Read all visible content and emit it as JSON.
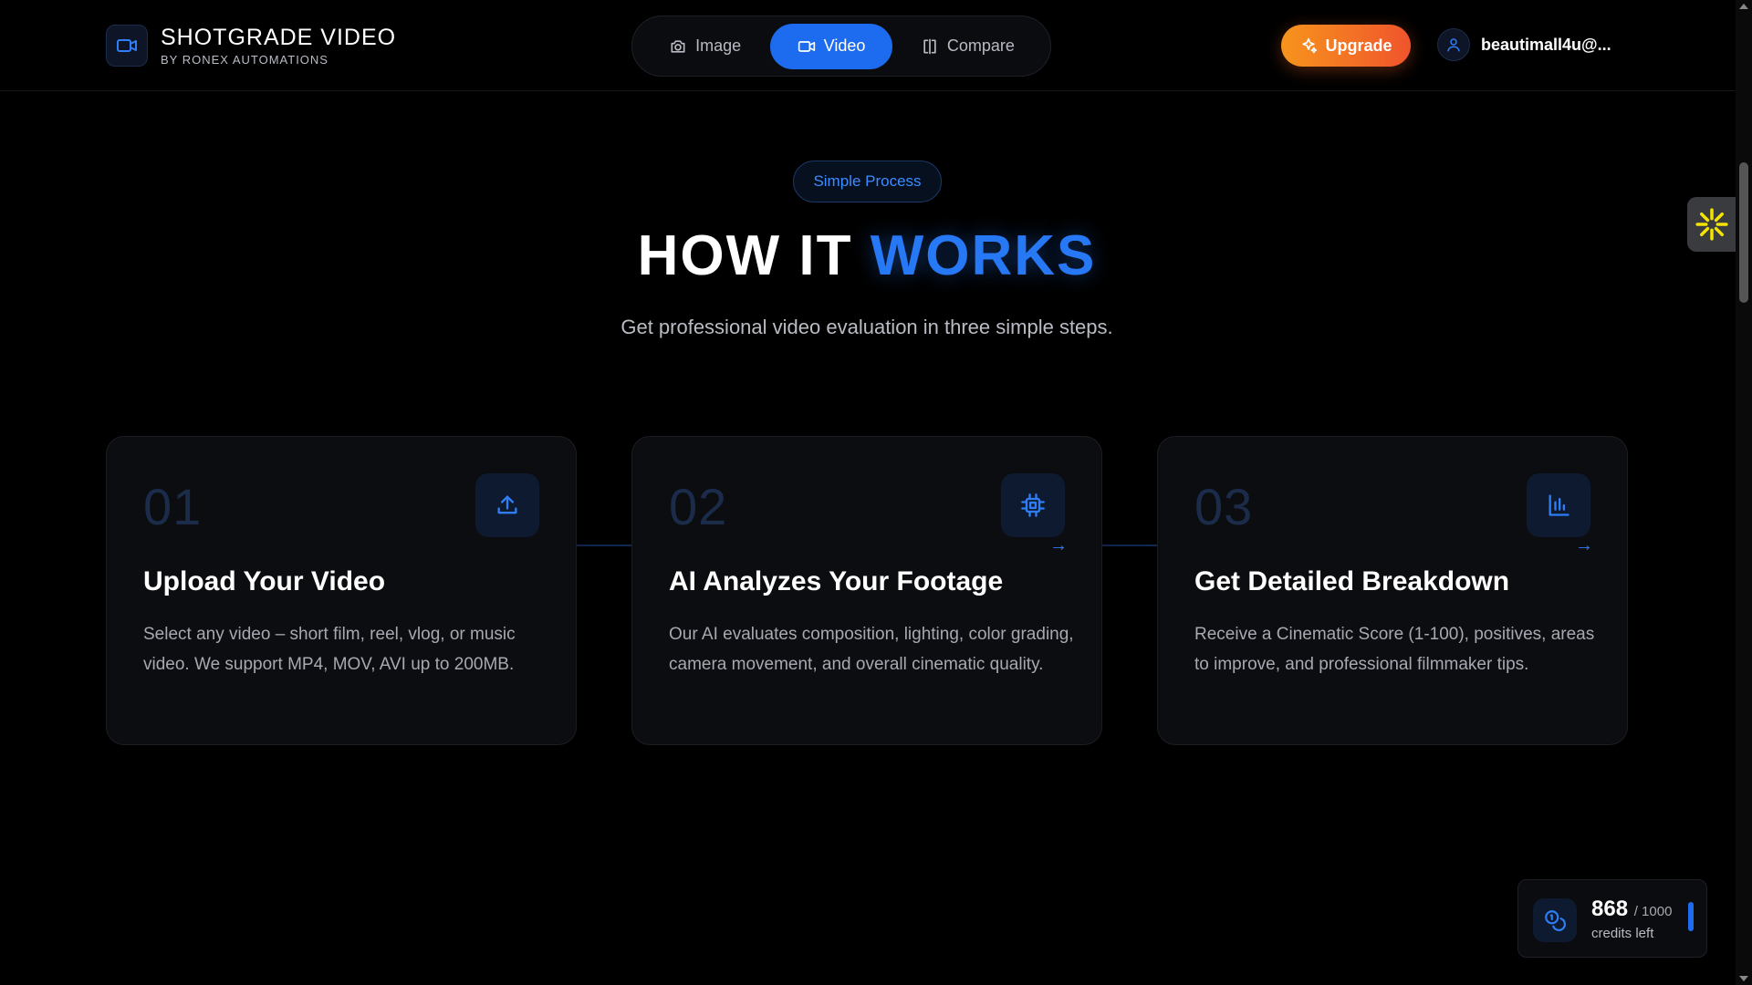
{
  "brand": {
    "title": "SHOTGRADE VIDEO",
    "subtitle": "BY RONEX AUTOMATIONS",
    "logo_icon": "video-camera-icon"
  },
  "mode_switch": {
    "items": [
      {
        "label": "Image",
        "icon": "camera-icon",
        "active": false
      },
      {
        "label": "Video",
        "icon": "video-camera-icon",
        "active": true
      },
      {
        "label": "Compare",
        "icon": "compare-icon",
        "active": false
      }
    ]
  },
  "upgrade": {
    "label": "Upgrade",
    "icon": "sparkles-icon"
  },
  "user": {
    "email": "beautimall4u@...",
    "icon": "user-icon"
  },
  "hero": {
    "badge": "Simple Process",
    "title_part1": "HOW IT",
    "title_part2": "WORKS",
    "subtitle": "Get professional video evaluation in three simple steps."
  },
  "steps": [
    {
      "number": "01",
      "icon": "upload-icon",
      "title": "Upload Your Video",
      "text": "Select any video – short film, reel, vlog, or music video. We support MP4, MOV, AVI up to 200MB."
    },
    {
      "number": "02",
      "icon": "cpu-chip-icon",
      "title": "AI Analyzes Your Footage",
      "text": "Our AI evaluates composition, lighting, color grading, camera movement, and overall cinematic quality."
    },
    {
      "number": "03",
      "icon": "bar-chart-icon",
      "title": "Get Detailed Breakdown",
      "text": "Receive a Cinematic Score (1-100), positives, areas to improve, and professional filmmaker tips."
    }
  ],
  "credits": {
    "used": "868",
    "total": "/ 1000",
    "label": "credits left",
    "icon": "coins-icon"
  },
  "colors": {
    "accent": "#1d6cf0",
    "accent_text": "#2778f5",
    "upgrade_start": "#f7941d",
    "upgrade_end": "#f0542c",
    "background": "#000000"
  }
}
